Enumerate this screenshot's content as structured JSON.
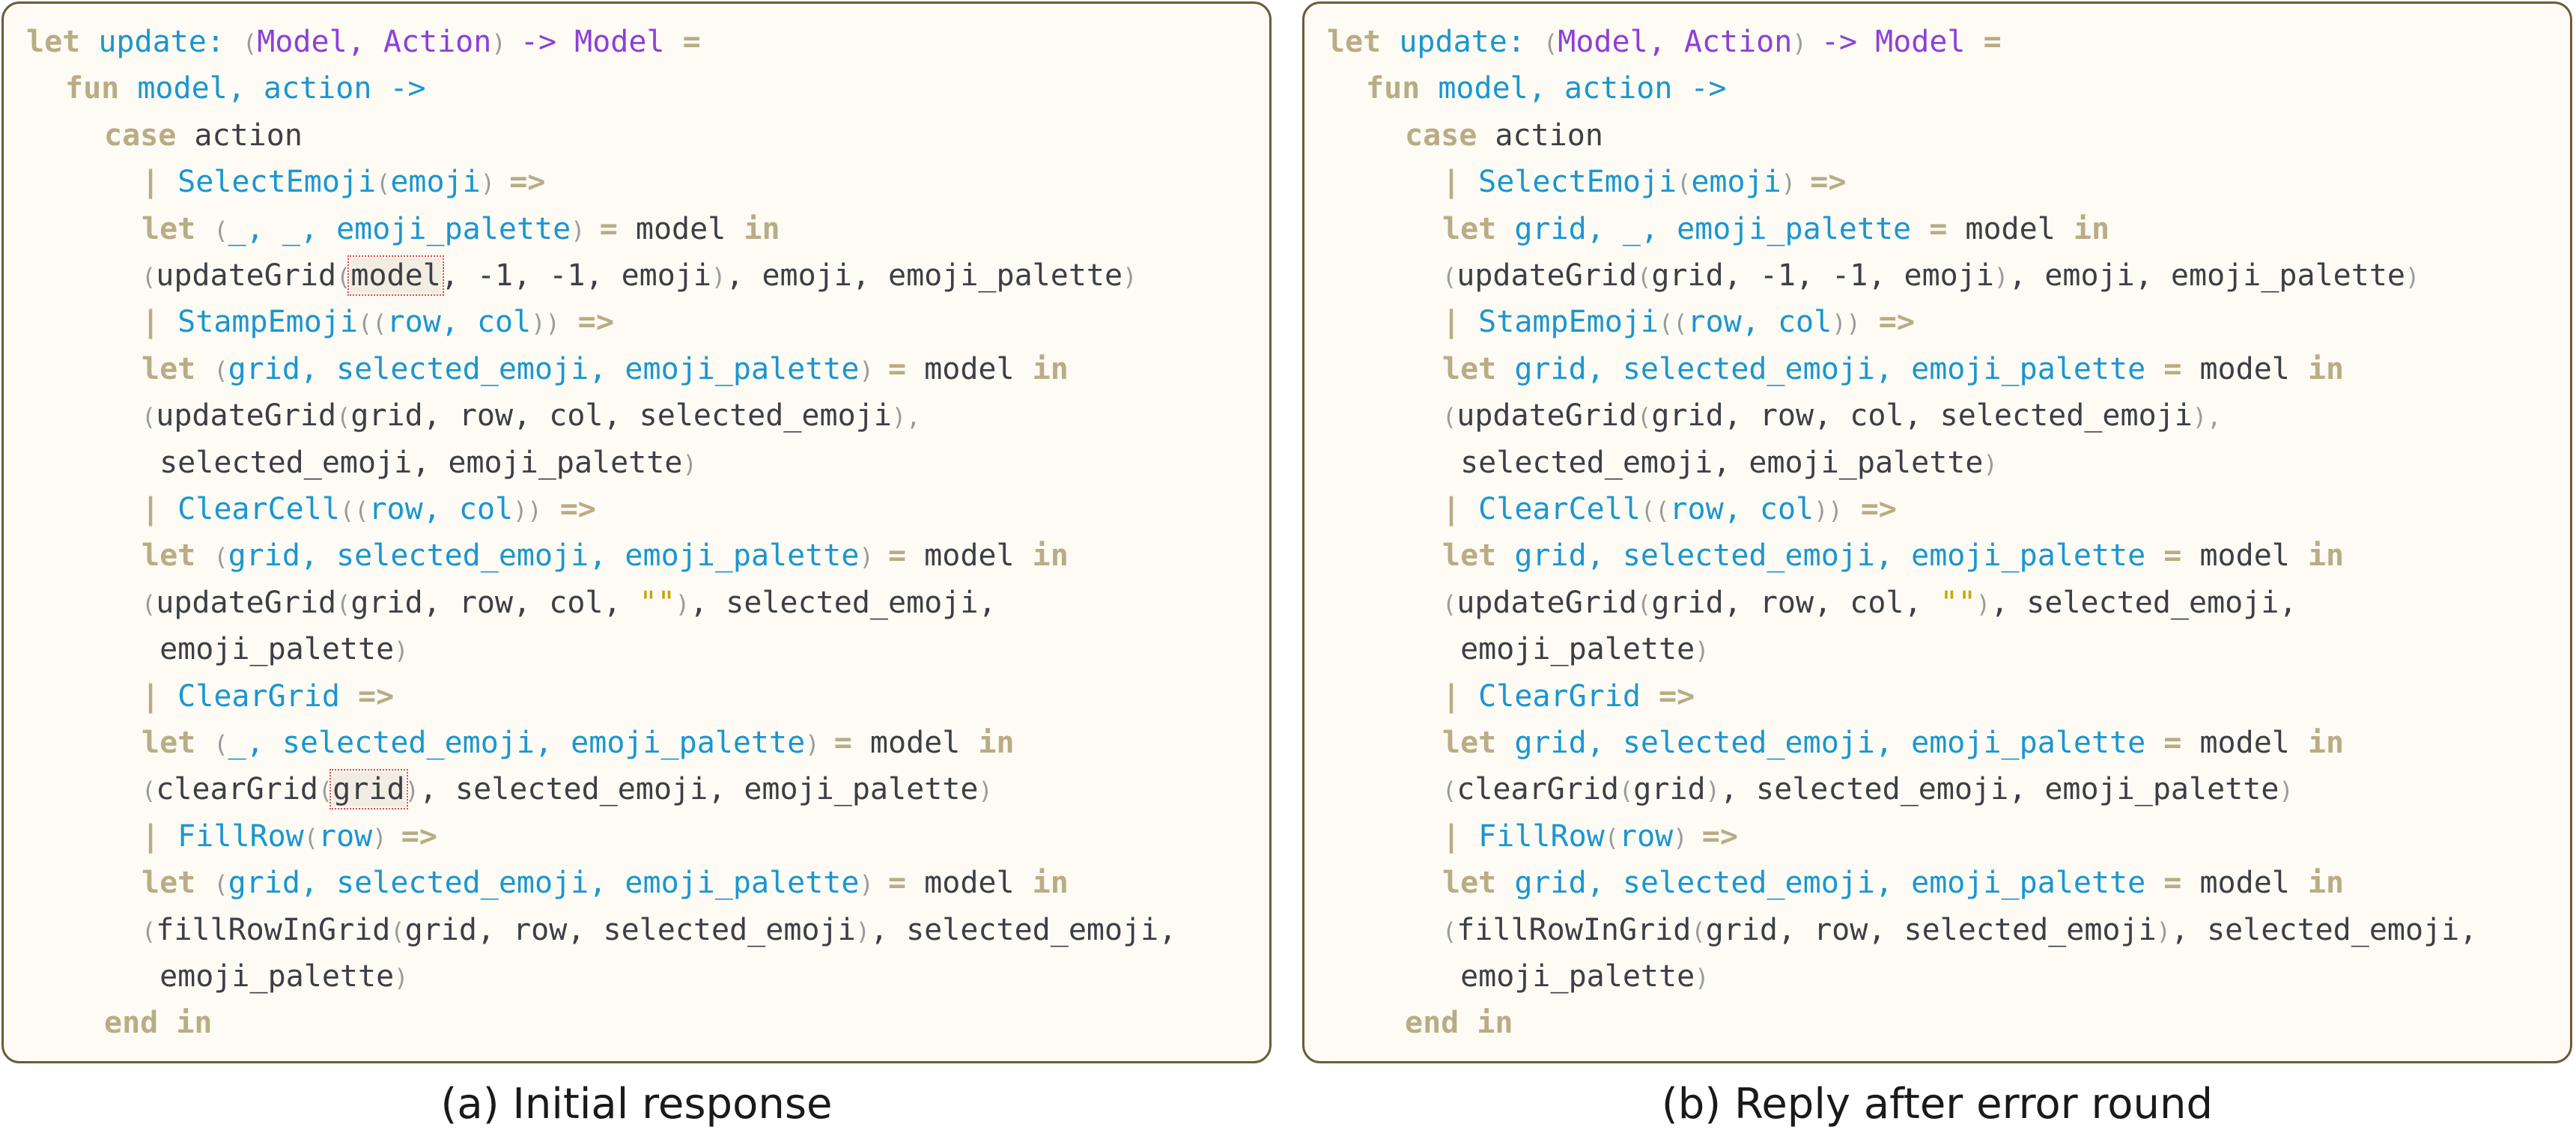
{
  "captions": {
    "a": "(a) Initial response",
    "b": "(b) Reply after error round"
  },
  "colors": {
    "keyword": "#b9ac86",
    "identifier": "#1a96d2",
    "type": "#8d3fdc",
    "punctuation": "#9a9a9a",
    "string": "#c9a100",
    "text": "#3c3f44",
    "highlight_border": "#d84b4b",
    "panel_background": "#fdfbf3",
    "panel_border": "#6b5a3a"
  },
  "panels": [
    {
      "lines": [
        [
          [
            "kw",
            "let "
          ],
          [
            "fn",
            "update: "
          ],
          [
            "p",
            "("
          ],
          [
            "ty",
            "Model, Action"
          ],
          [
            "p",
            ") "
          ],
          [
            "ty",
            "-> Model "
          ],
          [
            "kw",
            "="
          ]
        ],
        [
          [
            "kw",
            "fun "
          ],
          [
            "fn",
            "model, action ->"
          ]
        ],
        [
          [
            "kw",
            "case "
          ],
          [
            "x",
            "action"
          ]
        ],
        [
          [
            "kw",
            "| "
          ],
          [
            "fn",
            "SelectEmoji"
          ],
          [
            "p",
            "("
          ],
          [
            "fn",
            "emoji"
          ],
          [
            "p",
            ") "
          ],
          [
            "kw",
            "=>"
          ]
        ],
        [
          [
            "kw",
            "let "
          ],
          [
            "p",
            "("
          ],
          [
            "fn",
            "_, _, emoji_palette"
          ],
          [
            "p",
            ") "
          ],
          [
            "kw",
            "= "
          ],
          [
            "x",
            "model "
          ],
          [
            "kw",
            "in"
          ]
        ],
        [
          [
            "p",
            "("
          ],
          [
            "x",
            "updateGrid"
          ],
          [
            "p",
            "("
          ],
          [
            "hl",
            "model"
          ],
          [
            "x",
            ", -1, -1, emoji"
          ],
          [
            "p",
            ")"
          ],
          [
            "x",
            ", emoji, emoji_palette"
          ],
          [
            "p",
            ")"
          ]
        ],
        [
          [
            "kw",
            "| "
          ],
          [
            "fn",
            "StampEmoji"
          ],
          [
            "p",
            "(("
          ],
          [
            "fn",
            "row, col"
          ],
          [
            "p",
            "))"
          ],
          [
            "kw",
            " =>"
          ]
        ],
        [
          [
            "kw",
            "let "
          ],
          [
            "p",
            "("
          ],
          [
            "fn",
            "grid, selected_emoji, emoji_palette"
          ],
          [
            "p",
            ") "
          ],
          [
            "kw",
            "= "
          ],
          [
            "x",
            "model "
          ],
          [
            "kw",
            "in"
          ]
        ],
        [
          [
            "p",
            "("
          ],
          [
            "x",
            "updateGrid"
          ],
          [
            "p",
            "("
          ],
          [
            "x",
            "grid, row, col, selected_emoji"
          ],
          [
            "p",
            "),"
          ]
        ],
        [
          [
            "x",
            " selected_emoji, emoji_palette"
          ],
          [
            "p",
            ")"
          ]
        ],
        [
          [
            "kw",
            "| "
          ],
          [
            "fn",
            "ClearCell"
          ],
          [
            "p",
            "(("
          ],
          [
            "fn",
            "row, col"
          ],
          [
            "p",
            "))"
          ],
          [
            "kw",
            " =>"
          ]
        ],
        [
          [
            "kw",
            "let "
          ],
          [
            "p",
            "("
          ],
          [
            "fn",
            "grid, selected_emoji, emoji_palette"
          ],
          [
            "p",
            ") "
          ],
          [
            "kw",
            "= "
          ],
          [
            "x",
            "model "
          ],
          [
            "kw",
            "in"
          ]
        ],
        [
          [
            "p",
            "("
          ],
          [
            "x",
            "updateGrid"
          ],
          [
            "p",
            "("
          ],
          [
            "x",
            "grid, row, col, "
          ],
          [
            "s",
            "\"\""
          ],
          [
            "p",
            ")"
          ],
          [
            "x",
            ", selected_emoji,"
          ]
        ],
        [
          [
            "x",
            " emoji_palette"
          ],
          [
            "p",
            ")"
          ]
        ],
        [
          [
            "kw",
            "| "
          ],
          [
            "fn",
            "ClearGrid "
          ],
          [
            "kw",
            "=>"
          ]
        ],
        [
          [
            "kw",
            "let "
          ],
          [
            "p",
            "("
          ],
          [
            "fn",
            "_, selected_emoji, emoji_palette"
          ],
          [
            "p",
            ") "
          ],
          [
            "kw",
            "= "
          ],
          [
            "x",
            "model "
          ],
          [
            "kw",
            "in"
          ]
        ],
        [
          [
            "p",
            "("
          ],
          [
            "x",
            "clearGrid"
          ],
          [
            "p",
            "("
          ],
          [
            "hl",
            "grid"
          ],
          [
            "p",
            ")"
          ],
          [
            "x",
            ", selected_emoji, emoji_palette"
          ],
          [
            "p",
            ")"
          ]
        ],
        [
          [
            "kw",
            "| "
          ],
          [
            "fn",
            "FillRow"
          ],
          [
            "p",
            "("
          ],
          [
            "fn",
            "row"
          ],
          [
            "p",
            ") "
          ],
          [
            "kw",
            "=>"
          ]
        ],
        [
          [
            "kw",
            "let "
          ],
          [
            "p",
            "("
          ],
          [
            "fn",
            "grid, selected_emoji, emoji_palette"
          ],
          [
            "p",
            ") "
          ],
          [
            "kw",
            "= "
          ],
          [
            "x",
            "model "
          ],
          [
            "kw",
            "in"
          ]
        ],
        [
          [
            "p",
            "("
          ],
          [
            "x",
            "fillRowInGrid"
          ],
          [
            "p",
            "("
          ],
          [
            "x",
            "grid, row, selected_emoji"
          ],
          [
            "p",
            ")"
          ],
          [
            "x",
            ", selected_emoji,"
          ]
        ],
        [
          [
            "x",
            " emoji_palette"
          ],
          [
            "p",
            ")"
          ]
        ],
        [
          [
            "kw",
            "end in"
          ]
        ]
      ]
    },
    {
      "lines": [
        [
          [
            "kw",
            "let "
          ],
          [
            "fn",
            "update: "
          ],
          [
            "p",
            "("
          ],
          [
            "ty",
            "Model, Action"
          ],
          [
            "p",
            ") "
          ],
          [
            "ty",
            "-> Model "
          ],
          [
            "kw",
            "="
          ]
        ],
        [
          [
            "kw",
            "fun "
          ],
          [
            "fn",
            "model, action ->"
          ]
        ],
        [
          [
            "kw",
            "case "
          ],
          [
            "x",
            "action"
          ]
        ],
        [
          [
            "kw",
            "| "
          ],
          [
            "fn",
            "SelectEmoji"
          ],
          [
            "p",
            "("
          ],
          [
            "fn",
            "emoji"
          ],
          [
            "p",
            ") "
          ],
          [
            "kw",
            "=>"
          ]
        ],
        [
          [
            "kw",
            "let "
          ],
          [
            "fn",
            "grid, _, emoji_palette "
          ],
          [
            "kw",
            "= "
          ],
          [
            "x",
            "model "
          ],
          [
            "kw",
            "in"
          ]
        ],
        [
          [
            "p",
            "("
          ],
          [
            "x",
            "updateGrid"
          ],
          [
            "p",
            "("
          ],
          [
            "x",
            "grid, -1, -1, emoji"
          ],
          [
            "p",
            ")"
          ],
          [
            "x",
            ", emoji, emoji_palette"
          ],
          [
            "p",
            ")"
          ]
        ],
        [
          [
            "kw",
            "| "
          ],
          [
            "fn",
            "StampEmoji"
          ],
          [
            "p",
            "(("
          ],
          [
            "fn",
            "row, col"
          ],
          [
            "p",
            "))"
          ],
          [
            "kw",
            " =>"
          ]
        ],
        [
          [
            "kw",
            "let "
          ],
          [
            "fn",
            "grid, selected_emoji, emoji_palette "
          ],
          [
            "kw",
            "= "
          ],
          [
            "x",
            "model "
          ],
          [
            "kw",
            "in"
          ]
        ],
        [
          [
            "p",
            "("
          ],
          [
            "x",
            "updateGrid"
          ],
          [
            "p",
            "("
          ],
          [
            "x",
            "grid, row, col, selected_emoji"
          ],
          [
            "p",
            "),"
          ]
        ],
        [
          [
            "x",
            " selected_emoji, emoji_palette"
          ],
          [
            "p",
            ")"
          ]
        ],
        [
          [
            "kw",
            "| "
          ],
          [
            "fn",
            "ClearCell"
          ],
          [
            "p",
            "(("
          ],
          [
            "fn",
            "row, col"
          ],
          [
            "p",
            "))"
          ],
          [
            "kw",
            " =>"
          ]
        ],
        [
          [
            "kw",
            "let "
          ],
          [
            "fn",
            "grid, selected_emoji, emoji_palette "
          ],
          [
            "kw",
            "= "
          ],
          [
            "x",
            "model "
          ],
          [
            "kw",
            "in"
          ]
        ],
        [
          [
            "p",
            "("
          ],
          [
            "x",
            "updateGrid"
          ],
          [
            "p",
            "("
          ],
          [
            "x",
            "grid, row, col, "
          ],
          [
            "s",
            "\"\""
          ],
          [
            "p",
            ")"
          ],
          [
            "x",
            ", selected_emoji,"
          ]
        ],
        [
          [
            "x",
            " emoji_palette"
          ],
          [
            "p",
            ")"
          ]
        ],
        [
          [
            "kw",
            "| "
          ],
          [
            "fn",
            "ClearGrid "
          ],
          [
            "kw",
            "=>"
          ]
        ],
        [
          [
            "kw",
            "let "
          ],
          [
            "fn",
            "grid, selected_emoji, emoji_palette "
          ],
          [
            "kw",
            "= "
          ],
          [
            "x",
            "model "
          ],
          [
            "kw",
            "in"
          ]
        ],
        [
          [
            "p",
            "("
          ],
          [
            "x",
            "clearGrid"
          ],
          [
            "p",
            "("
          ],
          [
            "x",
            "grid"
          ],
          [
            "p",
            ")"
          ],
          [
            "x",
            ", selected_emoji, emoji_palette"
          ],
          [
            "p",
            ")"
          ]
        ],
        [
          [
            "kw",
            "| "
          ],
          [
            "fn",
            "FillRow"
          ],
          [
            "p",
            "("
          ],
          [
            "fn",
            "row"
          ],
          [
            "p",
            ") "
          ],
          [
            "kw",
            "=>"
          ]
        ],
        [
          [
            "kw",
            "let "
          ],
          [
            "fn",
            "grid, selected_emoji, emoji_palette "
          ],
          [
            "kw",
            "= "
          ],
          [
            "x",
            "model "
          ],
          [
            "kw",
            "in"
          ]
        ],
        [
          [
            "p",
            "("
          ],
          [
            "x",
            "fillRowInGrid"
          ],
          [
            "p",
            "("
          ],
          [
            "x",
            "grid, row, selected_emoji"
          ],
          [
            "p",
            ")"
          ],
          [
            "x",
            ", selected_emoji,"
          ]
        ],
        [
          [
            "x",
            " emoji_palette"
          ],
          [
            "p",
            ")"
          ]
        ],
        [
          [
            "kw",
            "end in"
          ]
        ]
      ]
    }
  ]
}
